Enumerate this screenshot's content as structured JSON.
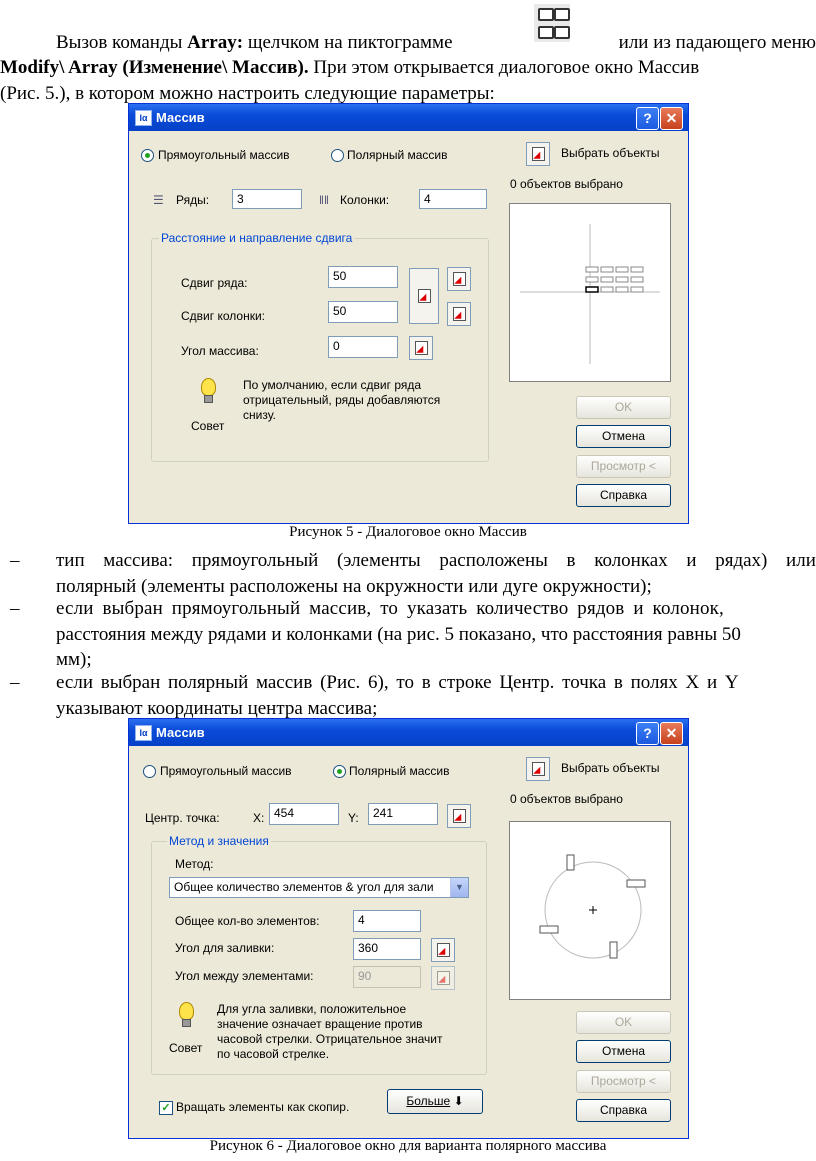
{
  "intro": {
    "t1": "Вызов команды ",
    "t1b": "Array:",
    "t2": " щелчком на пиктограмме",
    "t3": "или из падающего меню",
    "line2b": "Modify\\ Array (Изменение\\ Массив).",
    "line2": " При этом открывается диалоговое окно Массив",
    "line3": "(Рис. 5.), в котором можно настроить следующие параметры:"
  },
  "dialog1": {
    "title": "Массив",
    "help": "?",
    "close": "✕",
    "radio_rect": "Прямоугольный массив",
    "radio_polar": "Полярный массив",
    "select_objects": "Выбрать объекты",
    "selected_count": "0 объектов выбрано",
    "rows_label": "Ряды:",
    "rows_value": "3",
    "cols_label": "Колонки:",
    "cols_value": "4",
    "group_title": "Расстояние и направление сдвига",
    "row_offset_label": "Сдвиг ряда:",
    "row_offset_value": "50",
    "col_offset_label": "Сдвиг колонки:",
    "col_offset_value": "50",
    "angle_label": "Угол массива:",
    "angle_value": "0",
    "tip_text": [
      "По умолчанию, если сдвиг ряда",
      "отрицательный, ряды добавляются",
      "снизу."
    ],
    "tip_label": "Совет",
    "ok": "OK",
    "cancel": "Отмена",
    "preview": "Просмотр <",
    "help_btn": "Справка"
  },
  "caption1": "Рисунок 5 - Диалоговое окно Массив",
  "bullets": [
    [
      "тип массива: прямоугольный (элементы расположены в колонках и рядах) или",
      "полярный (элементы расположены на окружности или дуге окружности);"
    ],
    [
      "если выбран прямоугольный массив, то указать количество рядов и колонок,",
      "расстояния между рядами и колонками (на рис. 5 показано, что расстояния равны 50",
      "мм);"
    ],
    [
      "если выбран полярный массив (Рис. 6), то в строке Центр. точка в полях X и Y",
      "указывают координаты центра массива;"
    ]
  ],
  "dialog2": {
    "title": "Массив",
    "help": "?",
    "close": "✕",
    "radio_rect": "Прямоугольный массив",
    "radio_polar": "Полярный массив",
    "select_objects": "Выбрать объекты",
    "selected_count": "0 объектов выбрано",
    "center_label": "Центр. точка:",
    "x_label": "X:",
    "x_value": "454",
    "y_label": "Y:",
    "y_value": "241",
    "group_title": "Метод и значения",
    "method_label": "Метод:",
    "method_value": "Общее количество элементов & угол для зали",
    "total_label": "Общее кол-во элементов:",
    "total_value": "4",
    "fill_label": "Угол для заливки:",
    "fill_value": "360",
    "between_label": "Угол между элементами:",
    "between_value": "90",
    "tip_text": [
      "Для угла заливки, положительное",
      "значение означает вращение против",
      "часовой стрелки. Отрицательное значит",
      "по часовой стрелке."
    ],
    "tip_label": "Совет",
    "rotate_label": "Вращать элементы как скопир.",
    "more_btn": "Больше",
    "ok": "OK",
    "cancel": "Отмена",
    "preview": "Просмотр <",
    "help_btn": "Справка"
  },
  "caption2": "Рисунок 6 - Диалоговое окно для варианта полярного массива"
}
